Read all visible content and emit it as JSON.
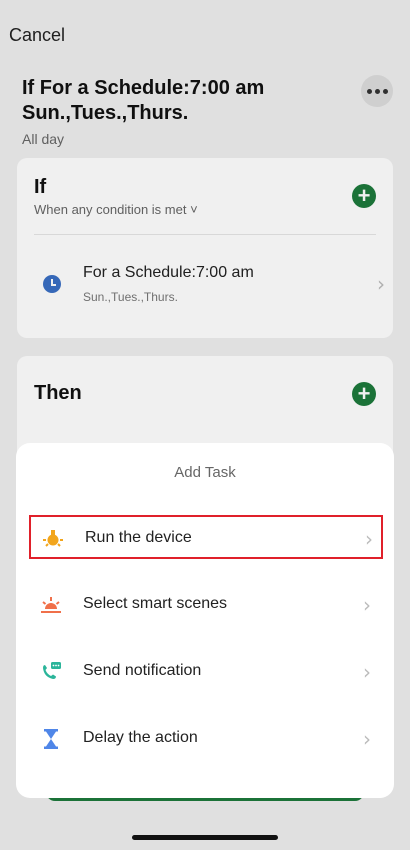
{
  "header": {
    "cancel_label": "Cancel",
    "title": "If For a Schedule:7:00 am Sun.,Tues.,Thurs.",
    "subtitle": "All day"
  },
  "if_card": {
    "title": "If",
    "condition_mode": "When any condition is met ˅",
    "conditions": [
      {
        "title": "For a Schedule:7:00 am",
        "subtitle": "Sun.,Tues.,Thurs.",
        "icon": "clock-icon"
      }
    ]
  },
  "then_card": {
    "title": "Then"
  },
  "sheet": {
    "title": "Add Task",
    "items": [
      {
        "label": "Run the device",
        "icon": "bulb-icon",
        "selected": true
      },
      {
        "label": "Select smart scenes",
        "icon": "sunrise-icon",
        "selected": false
      },
      {
        "label": "Send notification",
        "icon": "phone-message-icon",
        "selected": false
      },
      {
        "label": "Delay the action",
        "icon": "hourglass-icon",
        "selected": false
      }
    ]
  },
  "colors": {
    "accent_green": "#1d7a3c",
    "highlight_red": "#e0202a",
    "icon_orange": "#f2a51c",
    "icon_coral": "#f0704a",
    "icon_teal": "#2bb59a",
    "icon_blue": "#4f86e8"
  }
}
